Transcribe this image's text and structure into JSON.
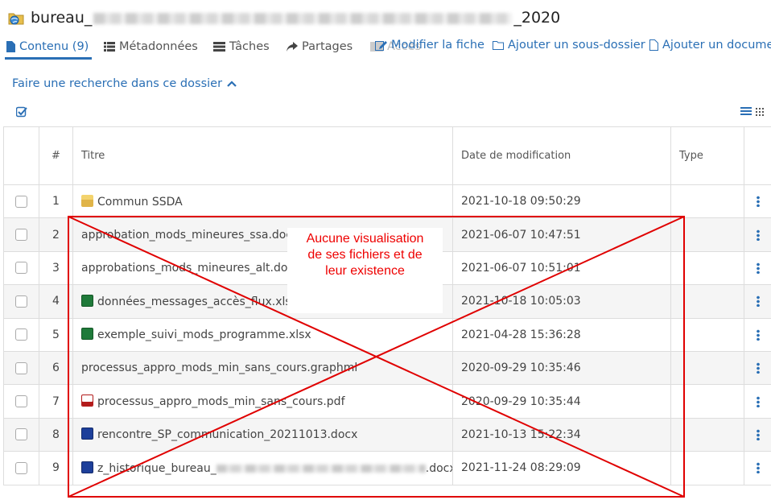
{
  "header": {
    "title_prefix": "bureau_",
    "title_suffix": "_2020"
  },
  "tabs": [
    {
      "label": "Contenu (9)",
      "icon": "file-icon"
    },
    {
      "label": "Métadonnées",
      "icon": "list-icon"
    },
    {
      "label": "Tâches",
      "icon": "tasks-icon"
    },
    {
      "label": "Partages",
      "icon": "share-icon"
    },
    {
      "label": "Accès",
      "icon": "access-icon"
    }
  ],
  "actions": [
    {
      "label": "Modifier la fiche",
      "icon": "edit-icon"
    },
    {
      "label": "Ajouter un sous-dossier",
      "icon": "folder-icon"
    },
    {
      "label": "Ajouter un document",
      "icon": "document-icon"
    }
  ],
  "search": {
    "label": "Faire une recherche dans ce dossier"
  },
  "table": {
    "columns": [
      "#",
      "Titre",
      "Date de modification",
      "Type"
    ],
    "rows": [
      {
        "num": "1",
        "title": "Commun SSDA",
        "date": "2021-10-18 09:50:29",
        "icon": "folder"
      },
      {
        "num": "2",
        "title": "approbation_mods_mineures_ssa.docx",
        "date": "2021-06-07 10:47:51",
        "icon": ""
      },
      {
        "num": "3",
        "title": "approbations_mods_mineures_alt.docx",
        "date": "2021-06-07 10:51:01",
        "icon": ""
      },
      {
        "num": "4",
        "title": "données_messages_accès_flux.xlsx",
        "date": "2021-10-18 10:05:03",
        "icon": "xlsx"
      },
      {
        "num": "5",
        "title": "exemple_suivi_mods_programme.xlsx",
        "date": "2021-04-28 15:36:28",
        "icon": "xlsx"
      },
      {
        "num": "6",
        "title": "processus_appro_mods_min_sans_cours.graphml",
        "date": "2020-09-29 10:35:46",
        "icon": ""
      },
      {
        "num": "7",
        "title": "processus_appro_mods_min_sans_cours.pdf",
        "date": "2020-09-29 10:35:44",
        "icon": "pdf"
      },
      {
        "num": "8",
        "title": "rencontre_SP_communication_20211013.docx",
        "date": "2021-10-13 15:22:34",
        "icon": "docx"
      },
      {
        "num": "9",
        "title_prefix": "z_historique_bureau_",
        "title_suffix": ".docx",
        "date": "2021-11-24 08:29:09",
        "icon": "docx"
      }
    ]
  },
  "annotation": {
    "line1": "Aucune visualisation",
    "line2": "de ses fichiers et de",
    "line3": "leur existence",
    "color": "#e00000"
  }
}
